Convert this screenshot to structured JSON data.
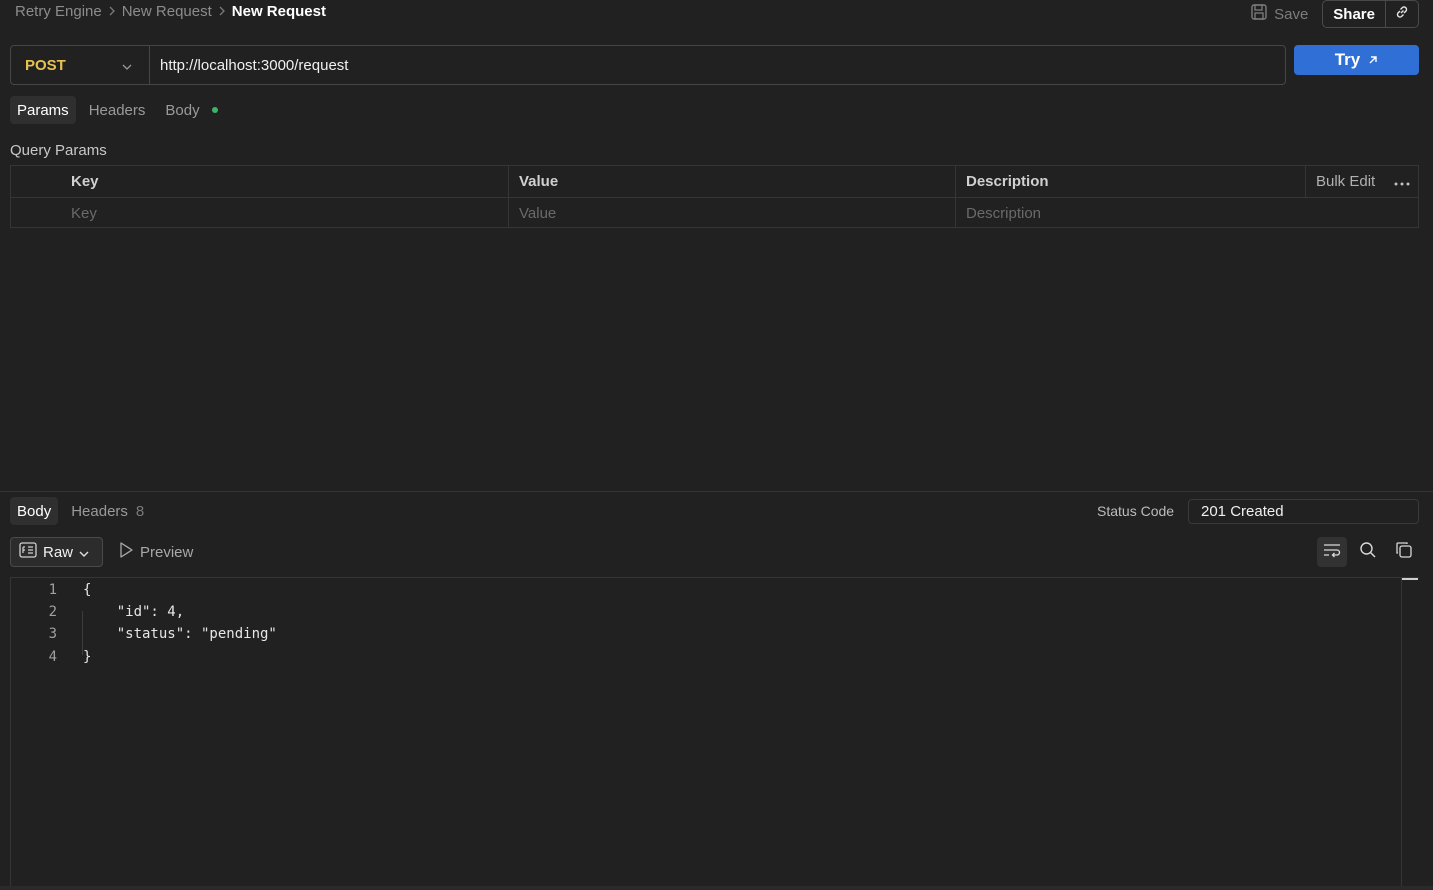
{
  "breadcrumb": {
    "items": [
      "Retry Engine",
      "New Request"
    ],
    "current": "New Request"
  },
  "top_actions": {
    "save_label": "Save",
    "share_label": "Share"
  },
  "request": {
    "method": "POST",
    "url": "http://localhost:3000/request",
    "try_label": "Try"
  },
  "request_tabs": [
    {
      "label": "Params",
      "active": true
    },
    {
      "label": "Headers",
      "active": false
    },
    {
      "label": "Body",
      "active": false,
      "indicator": true
    }
  ],
  "params": {
    "title": "Query Params",
    "columns": [
      "Key",
      "Value",
      "Description"
    ],
    "bulk_edit_label": "Bulk Edit",
    "placeholders": {
      "key": "Key",
      "value": "Value",
      "description": "Description"
    }
  },
  "response": {
    "tabs": [
      {
        "label": "Body",
        "active": true
      },
      {
        "label": "Headers",
        "count": "8",
        "active": false
      }
    ],
    "status_label": "Status Code",
    "status_value": "201 Created",
    "format_label": "Raw",
    "preview_label": "Preview",
    "lines": [
      {
        "num": "1",
        "text": "{"
      },
      {
        "num": "2",
        "text": "    \"id\": 4,"
      },
      {
        "num": "3",
        "text": "    \"status\": \"pending\""
      },
      {
        "num": "4",
        "text": "}"
      }
    ]
  },
  "colors": {
    "background": "#212121",
    "method": "#e8c250",
    "try_button": "#2f6fd6",
    "body_indicator": "#3bb36a"
  }
}
